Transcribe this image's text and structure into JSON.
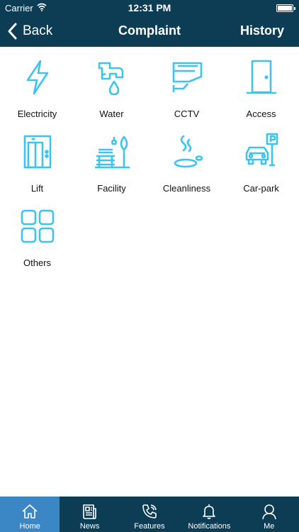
{
  "status_bar": {
    "carrier": "Carrier",
    "time": "12:31 PM"
  },
  "nav": {
    "back_label": "Back",
    "title": "Complaint",
    "history_label": "History"
  },
  "categories": [
    {
      "label": "Electricity",
      "icon": "lightning-icon"
    },
    {
      "label": "Water",
      "icon": "water-tap-icon"
    },
    {
      "label": "CCTV",
      "icon": "cctv-camera-icon"
    },
    {
      "label": "Access",
      "icon": "door-icon"
    },
    {
      "label": "Lift",
      "icon": "elevator-icon"
    },
    {
      "label": "Facility",
      "icon": "park-bench-icon"
    },
    {
      "label": "Cleanliness",
      "icon": "wet-floor-icon"
    },
    {
      "label": "Car-park",
      "icon": "car-park-icon"
    },
    {
      "label": "Others",
      "icon": "grid-squares-icon"
    }
  ],
  "tabs": [
    {
      "label": "Home",
      "icon": "home-icon",
      "active": true
    },
    {
      "label": "News",
      "icon": "newspaper-icon"
    },
    {
      "label": "Features",
      "icon": "phone-icon"
    },
    {
      "label": "Notifications",
      "icon": "bell-icon"
    },
    {
      "label": "Me",
      "icon": "user-icon"
    }
  ],
  "colors": {
    "header": "#0d3c55",
    "accent": "#3b86c4",
    "icon": "#3ec3f0"
  }
}
